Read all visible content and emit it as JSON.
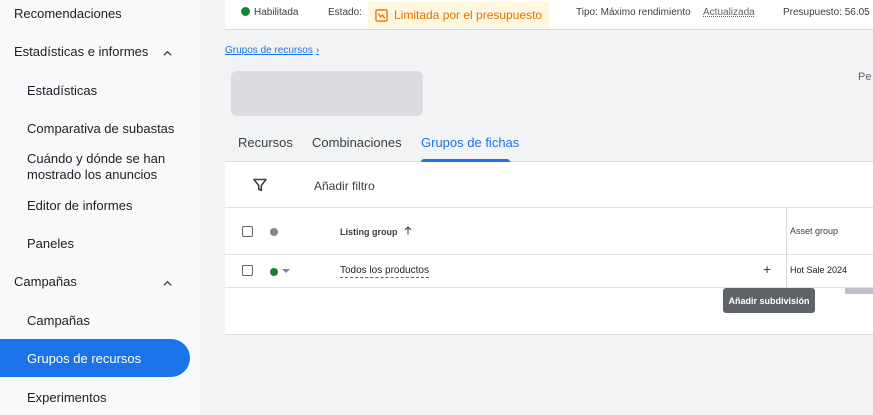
{
  "sidebar": {
    "items": [
      {
        "label": "Recomendaciones"
      },
      {
        "label": "Estadísticas e informes"
      },
      {
        "label": "Estadísticas"
      },
      {
        "label": "Comparativa de subastas"
      },
      {
        "label": "Cuándo y dónde se han mostrado los anuncios"
      },
      {
        "label": "Editor de informes"
      },
      {
        "label": "Paneles"
      },
      {
        "label": "Campañas"
      },
      {
        "label": "Campañas"
      },
      {
        "label": "Grupos de recursos"
      },
      {
        "label": "Experimentos"
      }
    ],
    "active_color": "#1a73e8"
  },
  "statusbar": {
    "status": "Habilitada",
    "estado_label": "Estado:",
    "estado_value": "Limitada por el presupuesto",
    "tipo": "Tipo: Máximo rendimiento",
    "actualizada": "Actualizada",
    "presupuesto": "Presupuesto: 56.05"
  },
  "breadcrumb": {
    "label": "Grupos de recursos"
  },
  "header": {
    "right_label": "Pe"
  },
  "tabs": [
    {
      "label": "Recursos"
    },
    {
      "label": "Combinaciones"
    },
    {
      "label": "Grupos de fichas"
    }
  ],
  "filter": {
    "label": "Añadir filtro",
    "icon": "filter-icon"
  },
  "table": {
    "headers": {
      "listing_group": "Listing group",
      "asset_group": "Asset group"
    },
    "rows": [
      {
        "name": "Todos los productos",
        "asset_group": "Hot Sale 2024"
      }
    ]
  },
  "tooltip": {
    "label": "Añadir subdivisión"
  }
}
